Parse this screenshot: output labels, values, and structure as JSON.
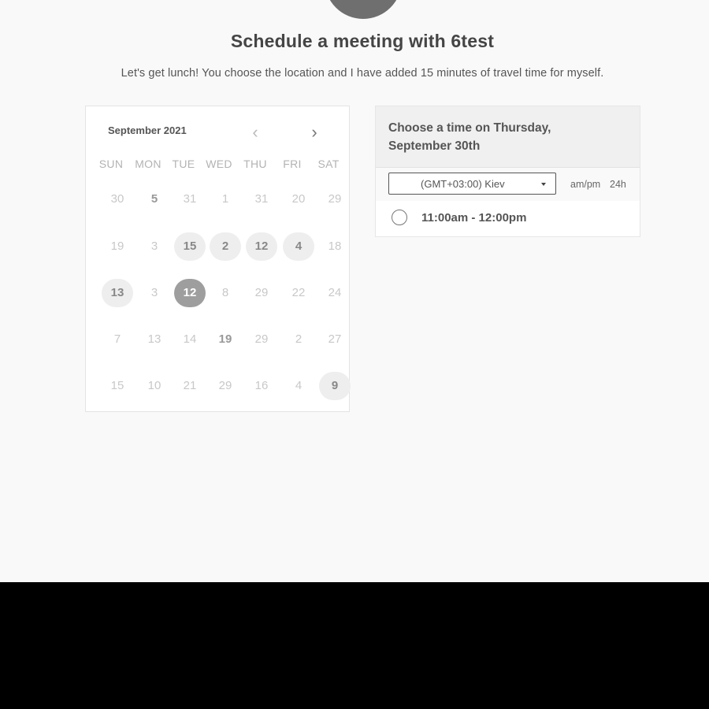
{
  "header": {
    "title": "Schedule a meeting with 6test",
    "subtitle": "Let's get lunch! You choose the location and I have added 15 minutes of travel time for myself."
  },
  "calendar": {
    "month": "September 2021",
    "prev_icon": "chevron-left-icon",
    "next_icon": "chevron-right-icon",
    "prev_glyph": "‹",
    "next_glyph": "›",
    "weekdays": [
      "SUN",
      "MON",
      "TUE",
      "WED",
      "THU",
      "FRI",
      "SAT"
    ],
    "weeks": [
      [
        {
          "label": "30",
          "state": "disabled"
        },
        {
          "label": "5",
          "state": "bold"
        },
        {
          "label": "31",
          "state": "disabled"
        },
        {
          "label": "1",
          "state": "disabled"
        },
        {
          "label": "31",
          "state": "disabled"
        },
        {
          "label": "20",
          "state": "disabled"
        },
        {
          "label": "29",
          "state": "disabled"
        }
      ],
      [
        {
          "label": "19",
          "state": "disabled"
        },
        {
          "label": "3",
          "state": "disabled"
        },
        {
          "label": "15",
          "state": "available"
        },
        {
          "label": "2",
          "state": "available"
        },
        {
          "label": "12",
          "state": "available"
        },
        {
          "label": "4",
          "state": "available"
        },
        {
          "label": "18",
          "state": "disabled"
        }
      ],
      [
        {
          "label": "13",
          "state": "available"
        },
        {
          "label": "3",
          "state": "disabled"
        },
        {
          "label": "12",
          "state": "selected"
        },
        {
          "label": "8",
          "state": "disabled"
        },
        {
          "label": "29",
          "state": "disabled"
        },
        {
          "label": "22",
          "state": "disabled"
        },
        {
          "label": "24",
          "state": "disabled"
        }
      ],
      [
        {
          "label": "7",
          "state": "disabled"
        },
        {
          "label": "13",
          "state": "disabled"
        },
        {
          "label": "14",
          "state": "disabled"
        },
        {
          "label": "19",
          "state": "bold"
        },
        {
          "label": "29",
          "state": "disabled"
        },
        {
          "label": "2",
          "state": "disabled"
        },
        {
          "label": "27",
          "state": "disabled"
        }
      ],
      [
        {
          "label": "15",
          "state": "disabled"
        },
        {
          "label": "10",
          "state": "disabled"
        },
        {
          "label": "21",
          "state": "disabled"
        },
        {
          "label": "29",
          "state": "disabled"
        },
        {
          "label": "16",
          "state": "disabled"
        },
        {
          "label": "4",
          "state": "disabled"
        },
        {
          "label": "9",
          "state": "available"
        }
      ]
    ]
  },
  "time_panel": {
    "title": "Choose a time on Thursday, September 30th",
    "timezone": "(GMT+03:00) Kiev",
    "format_ampm": "am/pm",
    "format_24h": "24h",
    "slots": [
      {
        "label": "11:00am - 12:00pm"
      }
    ]
  },
  "colors": {
    "selected_day": "#9e9e9e",
    "available_day": "#eeeeee",
    "bottom_bar": "#000000"
  }
}
